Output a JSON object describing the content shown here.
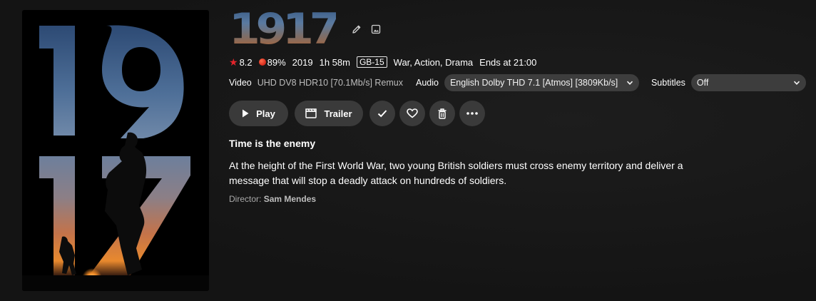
{
  "poster": {
    "title_digits_top": "19",
    "title_digits_bottom": "17"
  },
  "title": {
    "logo_text": "1917",
    "edit_icon": "pencil-icon",
    "image_icon": "image-icon"
  },
  "info": {
    "community_rating": "8.2",
    "critic_rating": "89%",
    "year": "2019",
    "runtime": "1h 58m",
    "official_rating": "GB-15",
    "genres": "War, Action, Drama",
    "ends_at": "Ends at 21:00"
  },
  "media": {
    "video_label": "Video",
    "video_value": "UHD DV8 HDR10 [70.1Mb/s] Remux",
    "audio_label": "Audio",
    "audio_value": "English Dolby THD 7.1 [Atmos] [3809Kb/s]",
    "subtitles_label": "Subtitles",
    "subtitles_value": "Off"
  },
  "buttons": {
    "play_label": "Play",
    "trailer_label": "Trailer"
  },
  "tagline": "Time is the enemy",
  "overview": "At the height of the First World War, two young British soldiers must cross enemy territory and deliver a message that will stop a deadly attack on hundreds of soldiers.",
  "director": {
    "label": "Director:",
    "name": "Sam Mendes"
  },
  "colors": {
    "background": "#161616",
    "button": "#3a3a3a",
    "select": "#3d3d3d",
    "star": "#e3242b"
  }
}
